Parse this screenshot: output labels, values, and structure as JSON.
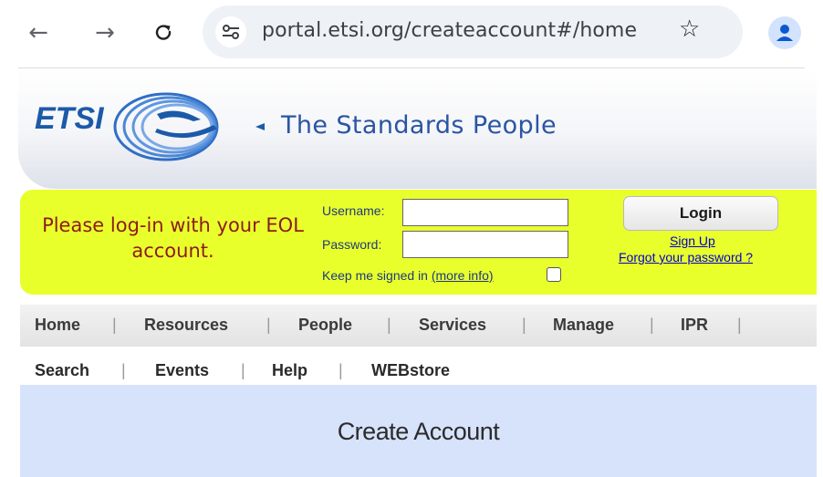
{
  "browser": {
    "url": "portal.etsi.org/createaccount#/home",
    "back_icon": "←",
    "forward_icon": "→",
    "reload_icon": "↻",
    "star_icon": "☆"
  },
  "banner": {
    "logo_text": "ETSI",
    "tagline": "The Standards People"
  },
  "login": {
    "message": "Please log-in with your EOL account.",
    "username_label": "Username:",
    "password_label": "Password:",
    "keep_signed_in_label": "Keep me signed in",
    "more_info_link": "(more info)",
    "login_button": "Login",
    "sign_up_link": "Sign Up",
    "forgot_password_link": "Forgot your password ?"
  },
  "nav_primary": [
    "Home",
    "Resources",
    "People",
    "Services",
    "Manage",
    "IPR"
  ],
  "nav_secondary": [
    "Search",
    "Events",
    "Help",
    "WEBstore"
  ],
  "page": {
    "title": "Create Account"
  },
  "colors": {
    "login_bar": "#e9ff2b",
    "login_message": "#8b1c1c",
    "brand_blue": "#1c5aa8",
    "create_panel": "#d7e3fb"
  }
}
